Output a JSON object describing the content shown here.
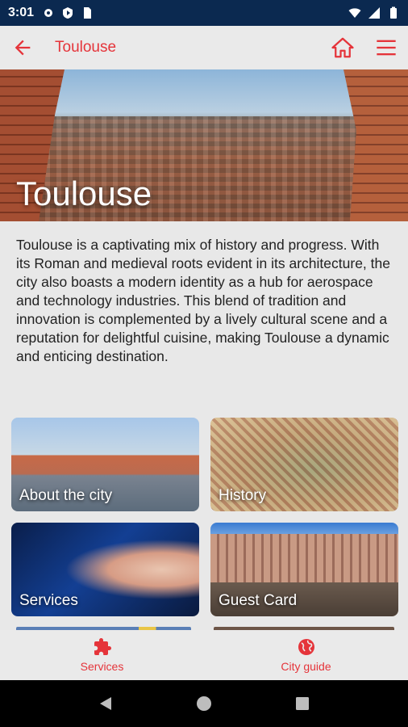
{
  "status_bar": {
    "time": "3:01"
  },
  "app_bar": {
    "title": "Toulouse"
  },
  "hero": {
    "title": "Toulouse"
  },
  "description": "Toulouse is a captivating mix of history and progress. With its Roman and medieval roots evident in its architecture, the city also boasts a modern identity as a hub for aerospace and technology industries. This blend of tradition and innovation is complemented by a lively cultural scene and a reputation for delightful cuisine, making Toulouse a dynamic and enticing destination.",
  "tiles": [
    {
      "label": "About the city"
    },
    {
      "label": "History"
    },
    {
      "label": "Services"
    },
    {
      "label": "Guest Card"
    }
  ],
  "bottom_nav": [
    {
      "label": "Services",
      "icon": "puzzle-icon"
    },
    {
      "label": "City guide",
      "icon": "globe-icon"
    }
  ],
  "colors": {
    "accent": "#e5343a",
    "status_bar": "#0b2950",
    "background": "#e8e8e8"
  }
}
